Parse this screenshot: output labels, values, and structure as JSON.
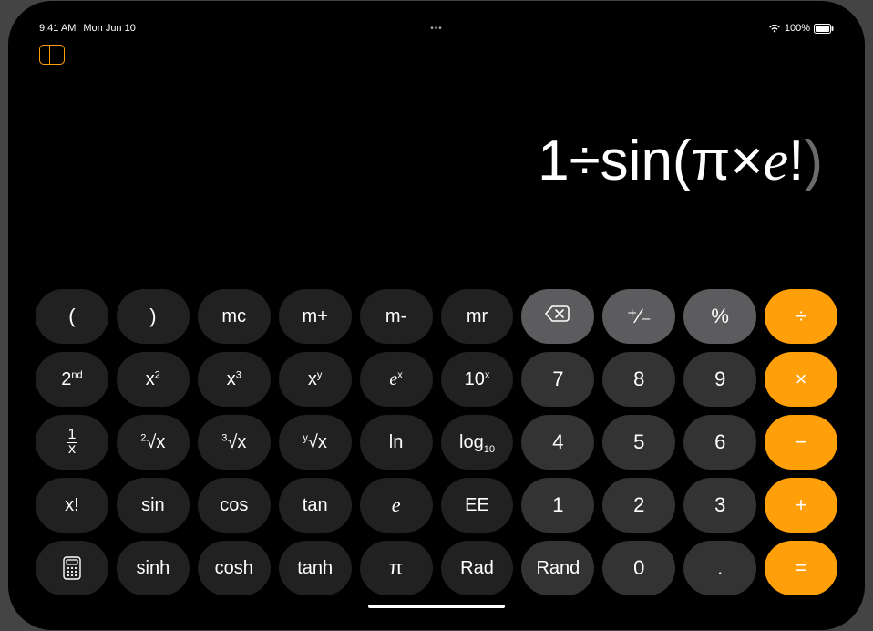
{
  "status": {
    "time": "9:41 AM",
    "date": "Mon Jun 10",
    "center": "•••",
    "battery_pct": "100%"
  },
  "display": {
    "seg1": "1÷sin(π×",
    "seg_e": "e",
    "seg_bang": "!",
    "seg_close": ")"
  },
  "keys": {
    "lparen": "(",
    "rparen": ")",
    "mc": "mc",
    "mplus": "m+",
    "mminus": "m-",
    "mr": "mr",
    "plusminus": "⁺∕₋",
    "percent": "%",
    "divide": "÷",
    "second_pre": "2",
    "second_suf": "nd",
    "x2_pre": "x",
    "x2_suf": "2",
    "x3_pre": "x",
    "x3_suf": "3",
    "xy_pre": "x",
    "xy_suf": "y",
    "ex_pre": "e",
    "ex_suf": "x",
    "tenx_pre": "10",
    "tenx_suf": "x",
    "seven": "7",
    "eight": "8",
    "nine": "9",
    "times": "×",
    "oneoverx_top": "1",
    "oneoverx_bot": "x",
    "root2_deg": "2",
    "root2_rad": "x",
    "root3_deg": "3",
    "root3_rad": "x",
    "rooty_deg": "y",
    "rooty_rad": "x",
    "ln": "ln",
    "log10_pre": "log",
    "log10_sub": "10",
    "four": "4",
    "five": "5",
    "six": "6",
    "minus": "−",
    "xfact": "x!",
    "sin": "sin",
    "cos": "cos",
    "tan": "tan",
    "e": "e",
    "EE": "EE",
    "one": "1",
    "two": "2",
    "three": "3",
    "plus": "+",
    "sinh": "sinh",
    "cosh": "cosh",
    "tanh": "tanh",
    "pi": "π",
    "rad": "Rad",
    "rand": "Rand",
    "zero": "0",
    "dot": ".",
    "equals": "="
  }
}
